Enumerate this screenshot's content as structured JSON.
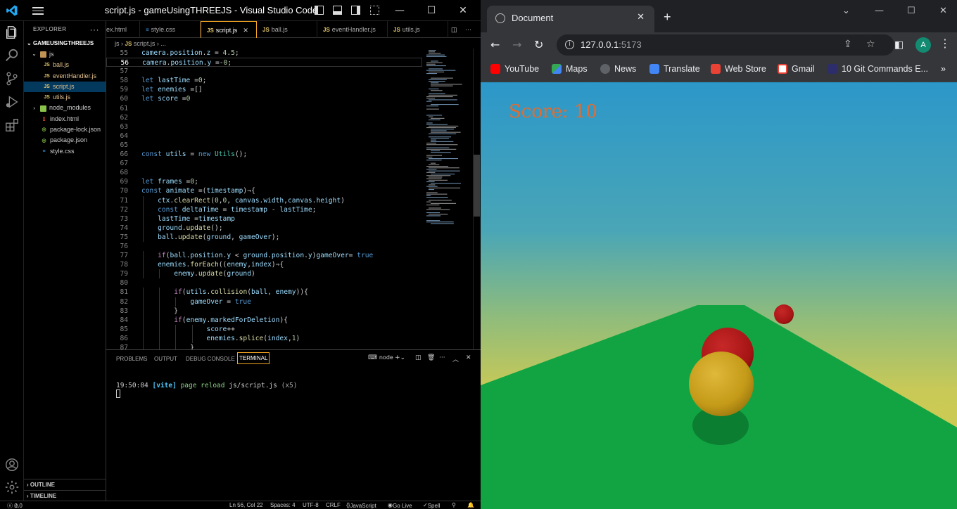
{
  "vscode": {
    "window_title": "script.js - gameUsingTHREEJS - Visual Studio Code",
    "explorer": {
      "header": "EXPLORER",
      "root": "GAMEUSINGTHREEJS",
      "items": [
        {
          "label": "js",
          "kind": "folder-open"
        },
        {
          "label": "ball.js",
          "kind": "js"
        },
        {
          "label": "eventHandler.js",
          "kind": "js"
        },
        {
          "label": "script.js",
          "kind": "js",
          "selected": true
        },
        {
          "label": "utils.js",
          "kind": "js"
        },
        {
          "label": "node_modules",
          "kind": "folder"
        },
        {
          "label": "index.html",
          "kind": "html"
        },
        {
          "label": "package-lock.json",
          "kind": "json"
        },
        {
          "label": "package.json",
          "kind": "json"
        },
        {
          "label": "style.css",
          "kind": "css"
        }
      ],
      "outline": "OUTLINE",
      "timeline": "TIMELINE"
    },
    "tabs": [
      {
        "label": "ex.html"
      },
      {
        "label": "style.css"
      },
      {
        "label": "script.js",
        "active": true
      },
      {
        "label": "ball.js"
      },
      {
        "label": "eventHandler.js"
      },
      {
        "label": "utils.js"
      }
    ],
    "breadcrumb": {
      "folder": "js",
      "file": "script.js",
      "tail": "..."
    },
    "code_lines": [
      {
        "n": "55",
        "t": "camera.position.z = 4.5;"
      },
      {
        "n": "56",
        "t": "camera.position.y =-0;"
      },
      {
        "n": "57",
        "t": ""
      },
      {
        "n": "58",
        "t": "let lastTime =0;"
      },
      {
        "n": "59",
        "t": "let enemies =[]"
      },
      {
        "n": "60",
        "t": "let score =0"
      },
      {
        "n": "61",
        "t": ""
      },
      {
        "n": "62",
        "t": ""
      },
      {
        "n": "63",
        "t": ""
      },
      {
        "n": "64",
        "t": ""
      },
      {
        "n": "65",
        "t": ""
      },
      {
        "n": "66",
        "t": "const utils = new Utils();"
      },
      {
        "n": "67",
        "t": ""
      },
      {
        "n": "68",
        "t": ""
      },
      {
        "n": "69",
        "t": "let frames =0;"
      },
      {
        "n": "70",
        "t": "const animate =(timestamp)⇒{"
      },
      {
        "n": "71",
        "t": "    ctx.clearRect(0,0, canvas.width,canvas.height)"
      },
      {
        "n": "72",
        "t": "    const deltaTime = timestamp - lastTime;"
      },
      {
        "n": "73",
        "t": "    lastTime =timestamp"
      },
      {
        "n": "74",
        "t": "    ground.update();"
      },
      {
        "n": "75",
        "t": "    ball.update(ground, gameOver);"
      },
      {
        "n": "76",
        "t": ""
      },
      {
        "n": "77",
        "t": "    if(ball.position.y < ground.position.y)gameOver= true"
      },
      {
        "n": "78",
        "t": "    enemies.forEach((enemy,index)⇒{"
      },
      {
        "n": "79",
        "t": "        enemy.update(ground)"
      },
      {
        "n": "80",
        "t": ""
      },
      {
        "n": "81",
        "t": "        if(utils.collision(ball, enemy)){"
      },
      {
        "n": "82",
        "t": "            gameOver = true"
      },
      {
        "n": "83",
        "t": "        }"
      },
      {
        "n": "84",
        "t": "        if(enemy.markedForDeletion){"
      },
      {
        "n": "85",
        "t": "                score++"
      },
      {
        "n": "86",
        "t": "                enemies.splice(index,1)"
      },
      {
        "n": "87",
        "t": "            }"
      }
    ],
    "panel": {
      "tabs": [
        "PROBLEMS",
        "OUTPUT",
        "DEBUG CONSOLE",
        "TERMINAL"
      ],
      "active_tab": "TERMINAL",
      "terminal_name": "node",
      "log": {
        "time": "19:50:04",
        "tag": "[vite]",
        "msg": "page reload",
        "path": "js/script.js",
        "count": "(x5)"
      }
    },
    "status": {
      "errors": "0",
      "warnings": "0",
      "position": "Ln 56, Col 22",
      "spaces": "Spaces: 4",
      "encoding": "UTF-8",
      "eol": "CRLF",
      "language": "JavaScript",
      "golive": "Go Live",
      "spell": "Spell"
    }
  },
  "browser": {
    "tab_title": "Document",
    "url_host": "127.0.0.1",
    "url_port": ":5173",
    "avatar_letter": "A",
    "bookmarks": [
      "YouTube",
      "Maps",
      "News",
      "Translate",
      "Web Store",
      "Gmail",
      "10 Git Commands E..."
    ],
    "game": {
      "score_text": "Score: 10",
      "colors": {
        "ground": "#12a443",
        "player": "#d4a71e",
        "enemy": "#b81c1c",
        "score": "#e56b2e"
      }
    }
  }
}
